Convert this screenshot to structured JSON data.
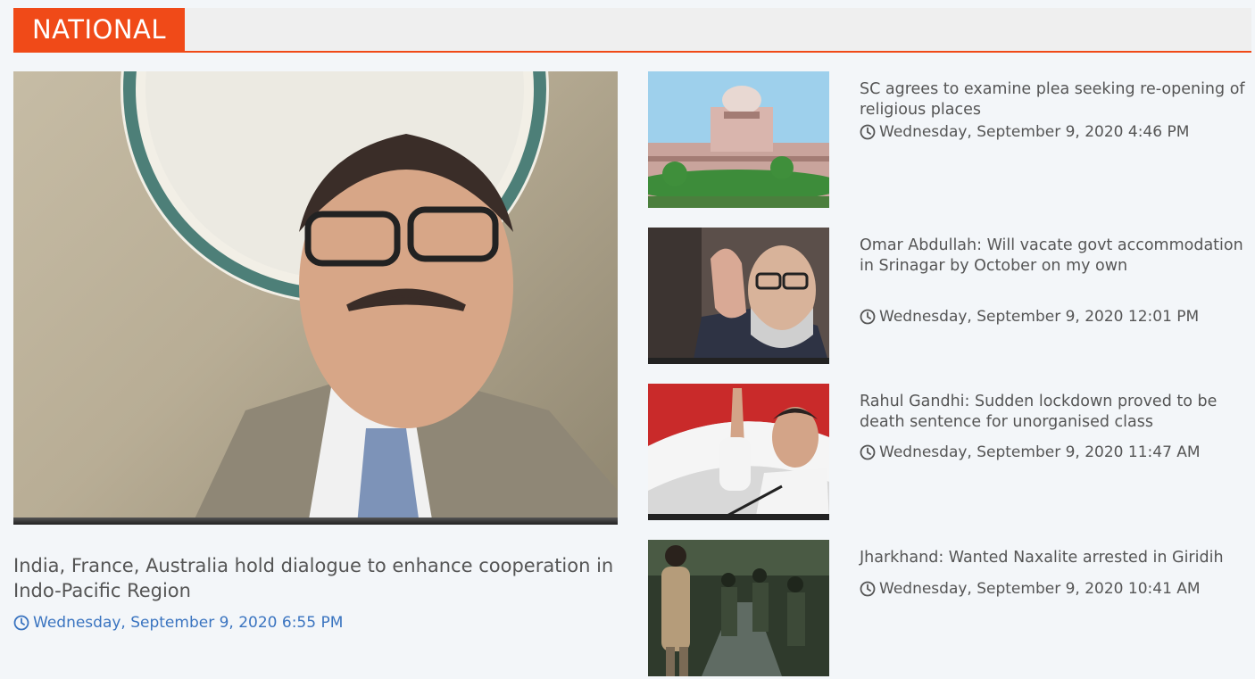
{
  "section": {
    "label": "NATIONAL"
  },
  "featured": {
    "title": "India, France, Australia hold dialogue to enhance cooperation in Indo-Pacific Region",
    "date": "Wednesday, September 9, 2020 6:55 PM"
  },
  "stories": [
    {
      "title": "SC agrees to examine plea seeking re-opening of religious places",
      "date": "Wednesday, September 9, 2020 4:46 PM"
    },
    {
      "title": "Omar Abdullah: Will vacate govt accommodation in Srinagar by October on my own",
      "date": "Wednesday, September 9, 2020 12:01 PM"
    },
    {
      "title": "Rahul Gandhi: Sudden lockdown proved to be death sentence for unorganised class",
      "date": "Wednesday, September 9, 2020 11:47 AM"
    },
    {
      "title": "Jharkhand: Wanted Naxalite arrested in Giridih",
      "date": "Wednesday, September 9, 2020 10:41 AM"
    }
  ],
  "colors": {
    "accent": "#f04a18",
    "date_link": "#3a74c0",
    "text": "#555555",
    "background": "#f3f6f9"
  },
  "icons": {
    "date": "clock-icon"
  }
}
